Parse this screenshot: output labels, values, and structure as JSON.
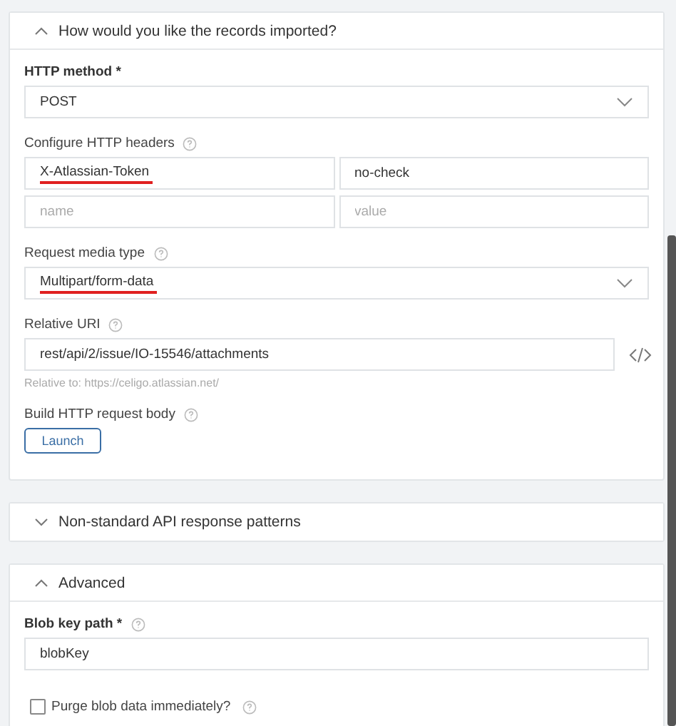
{
  "sections": [
    {
      "title": "How would you like the records imported?",
      "expanded": true,
      "fields": [
        {
          "kind": "select",
          "label": "HTTP method",
          "required_mark": "*",
          "help": false,
          "value": "POST",
          "underlined": false
        },
        {
          "kind": "headers",
          "label": "Configure HTTP headers",
          "help": true,
          "rows": [
            {
              "name": "X-Atlassian-Token",
              "value": "no-check",
              "underlined": true
            },
            {
              "name_placeholder": "name",
              "value_placeholder": "value"
            }
          ]
        },
        {
          "kind": "select",
          "label": "Request media type",
          "help": true,
          "value": "Multipart/form-data",
          "underlined": true
        },
        {
          "kind": "uri",
          "label": "Relative URI",
          "help": true,
          "value": "rest/api/2/issue/IO-15546/attachments",
          "hint": "Relative to: https://celigo.atlassian.net/"
        },
        {
          "kind": "button",
          "label": "Build HTTP request body",
          "help": true,
          "button": "Launch"
        }
      ]
    },
    {
      "title": "Non-standard API response patterns",
      "expanded": false
    },
    {
      "title": "Advanced",
      "expanded": true,
      "fields": [
        {
          "kind": "text",
          "label": "Blob key path",
          "required_mark": "*",
          "help": true,
          "value": "blobKey"
        },
        {
          "kind": "checkbox",
          "label": "Purge blob data immediately?",
          "help": true,
          "checked": false
        }
      ]
    }
  ]
}
